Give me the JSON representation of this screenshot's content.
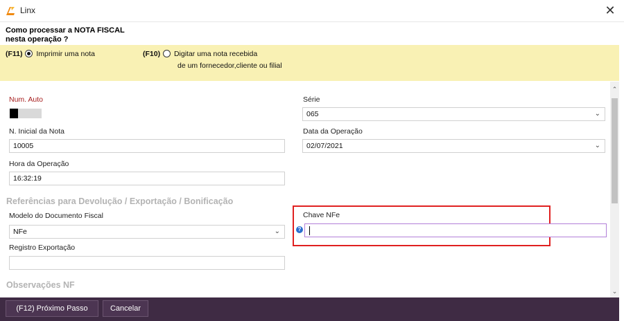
{
  "window": {
    "title": "Linx",
    "close_glyph": "✕"
  },
  "prompt": {
    "line1": "Como processar a NOTA FISCAL",
    "line2": "nesta operação ?"
  },
  "options": [
    {
      "key": "(F11)",
      "label": "Imprimir uma nota",
      "selected": true
    },
    {
      "key": "(F10)",
      "label_line1": "Digitar uma nota recebida",
      "label_line2": "de um fornecedor,cliente ou filial",
      "selected": false
    }
  ],
  "form": {
    "num_auto": {
      "label": "Num. Auto",
      "toggle_on": true
    },
    "serie": {
      "label": "Série",
      "value": "065"
    },
    "nota_inicial": {
      "label": "N. Inicial da Nota",
      "value": "10005"
    },
    "data_operacao": {
      "label": "Data da Operação",
      "value": "02/07/2021"
    },
    "hora_operacao": {
      "label": "Hora da Operação",
      "value": "16:32:19"
    },
    "section_referencias": "Referências para Devolução / Exportação / Bonificação",
    "modelo_documento": {
      "label": "Modelo do Documento Fiscal",
      "value": "NFe"
    },
    "chave_nfe": {
      "label": "Chave NFe",
      "value": ""
    },
    "registro_exportacao": {
      "label": "Registro Exportação",
      "value": ""
    },
    "section_observacoes": "Observações NF"
  },
  "footer": {
    "next_label": "(F12) Próximo Passo",
    "cancel_label": "Cancelar"
  },
  "icons": {
    "logo": "linx-logo-icon",
    "close": "close-icon",
    "dropdown": "chevron-down-icon",
    "info": "info-icon"
  },
  "colors": {
    "options_band": "#f9f1b4",
    "footer": "#3f2b44",
    "highlight": "#e02020",
    "red_label": "#a61d1d"
  }
}
